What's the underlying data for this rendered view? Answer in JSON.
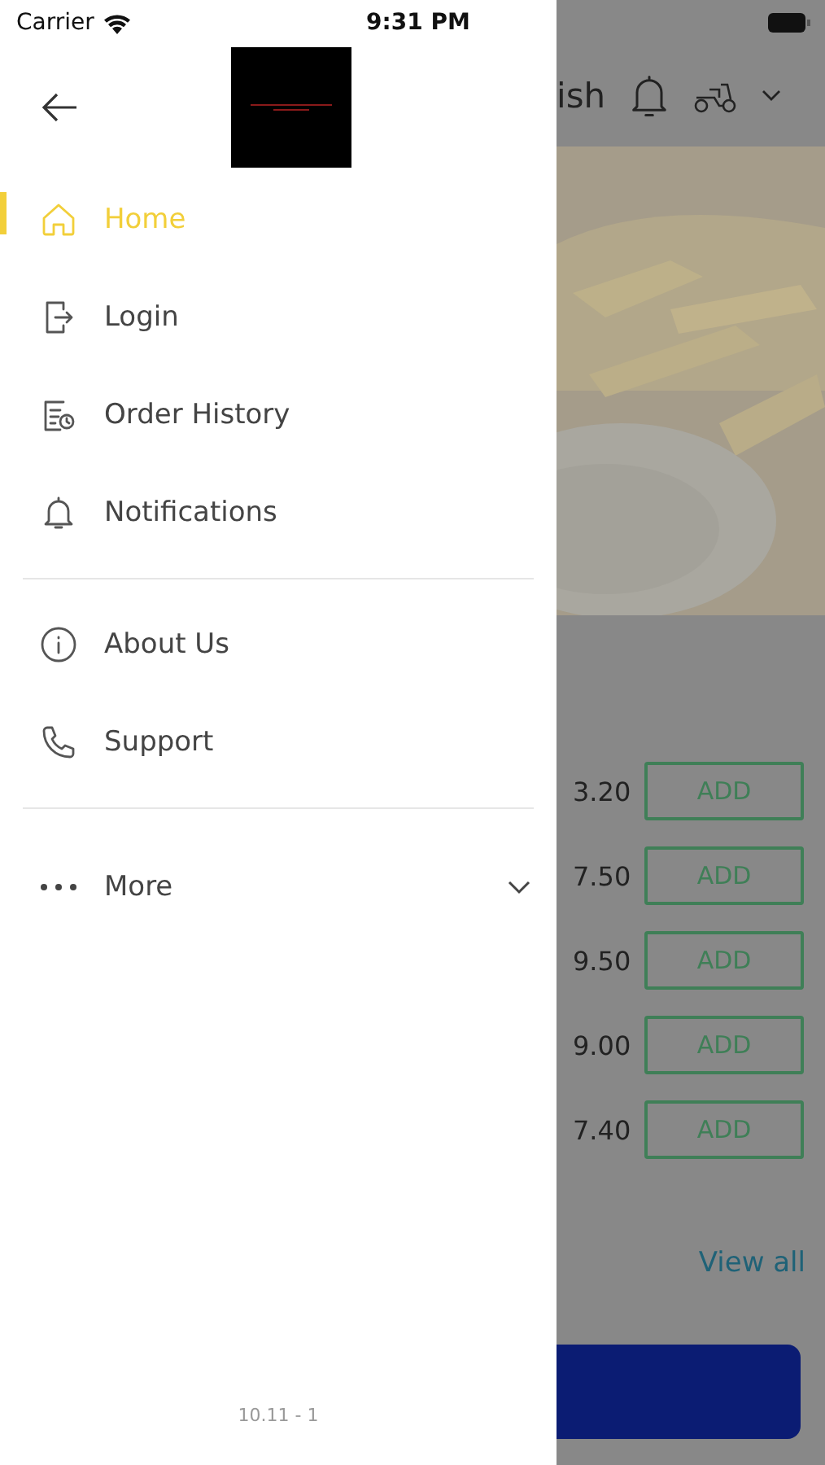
{
  "status_bar": {
    "carrier": "Carrier",
    "time": "9:31 PM"
  },
  "drawer": {
    "menu_groups": [
      [
        {
          "label": "Home",
          "kind": "home",
          "selected": true
        },
        {
          "label": "Login",
          "kind": "login",
          "selected": false
        },
        {
          "label": "Order History",
          "kind": "history",
          "selected": false
        },
        {
          "label": "Notifications",
          "kind": "bell",
          "selected": false
        }
      ],
      [
        {
          "label": "About Us",
          "kind": "info",
          "selected": false
        },
        {
          "label": "Support",
          "kind": "phone",
          "selected": false
        }
      ]
    ],
    "more": {
      "label": "More",
      "expanded": false
    },
    "version": "10.11 - 1"
  },
  "background_page": {
    "title": "ish",
    "items": [
      {
        "price": "3.20",
        "button": "ADD"
      },
      {
        "price": "7.50",
        "button": "ADD"
      },
      {
        "price": "9.50",
        "button": "ADD"
      },
      {
        "price": "9.00",
        "button": "ADD"
      },
      {
        "price": "7.40",
        "button": "ADD"
      }
    ],
    "view_all": "View all"
  }
}
